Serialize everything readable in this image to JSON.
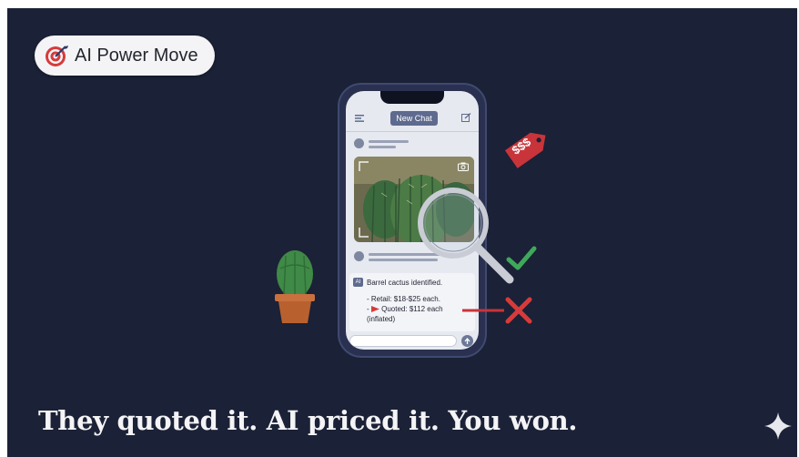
{
  "badge": {
    "label": "AI Power Move",
    "icon": "target-dart-icon"
  },
  "phone": {
    "new_chat_label": "New Chat",
    "menu_icon": "hamburger-menu-icon",
    "edit_icon": "compose-icon",
    "ai_tag": "AI",
    "identified_text": "Barrel cactus identified.",
    "retail_text": "- Retail: $18-$25 each.",
    "quoted_prefix": "- ",
    "quoted_text": "Quoted: $112 each",
    "inflated_text": "(inflated)"
  },
  "price_tag": {
    "label": "$$$",
    "color": "#c8343a"
  },
  "marks": {
    "check_color": "#3fa85b",
    "cross_color": "#d63b3b"
  },
  "headline": "They quoted it. AI priced it. You won.",
  "colors": {
    "background": "#1b2136",
    "accent_red": "#c8343a",
    "phone_body": "#2a3150"
  }
}
